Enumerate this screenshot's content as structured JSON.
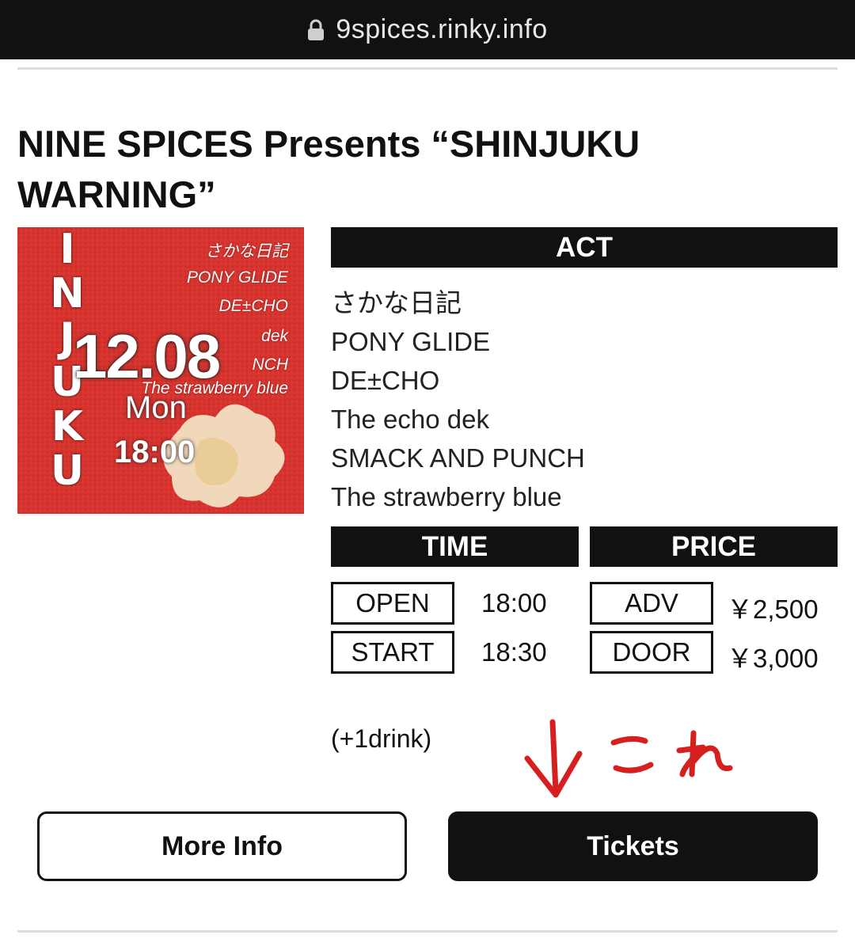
{
  "browser": {
    "url": "9spices.rinky.info"
  },
  "event": {
    "title": "NINE SPICES Presents “SHINJUKU WARNING”",
    "flyer": {
      "vertical_title": [
        "I",
        "N",
        "J",
        "U",
        "K",
        "U"
      ],
      "acts": [
        "さかな日記",
        "PONY GLIDE",
        "DE±CHO",
        "dek",
        "NCH",
        "The strawberry blue"
      ],
      "date": "12.08",
      "day": "Mon",
      "time": "18:00"
    },
    "act_header": "ACT",
    "acts": [
      "さかな日記",
      "PONY GLIDE",
      "DE±CHO",
      "The echo dek",
      "SMACK AND PUNCH",
      "The strawberry blue"
    ],
    "time_header": "TIME",
    "price_header": "PRICE",
    "open_label": "OPEN",
    "open_time": "18:00",
    "start_label": "START",
    "start_time": "18:30",
    "adv_label": "ADV",
    "adv_price": "￥2,500",
    "door_label": "DOOR",
    "door_price": "￥3,000",
    "drink_note": "(+1drink)",
    "annotation": "これ"
  },
  "buttons": {
    "more_info": "More Info",
    "tickets": "Tickets"
  },
  "colors": {
    "flyer_red": "#d8342f",
    "annotation_red": "#d61f1f",
    "bar_black": "#111111"
  }
}
